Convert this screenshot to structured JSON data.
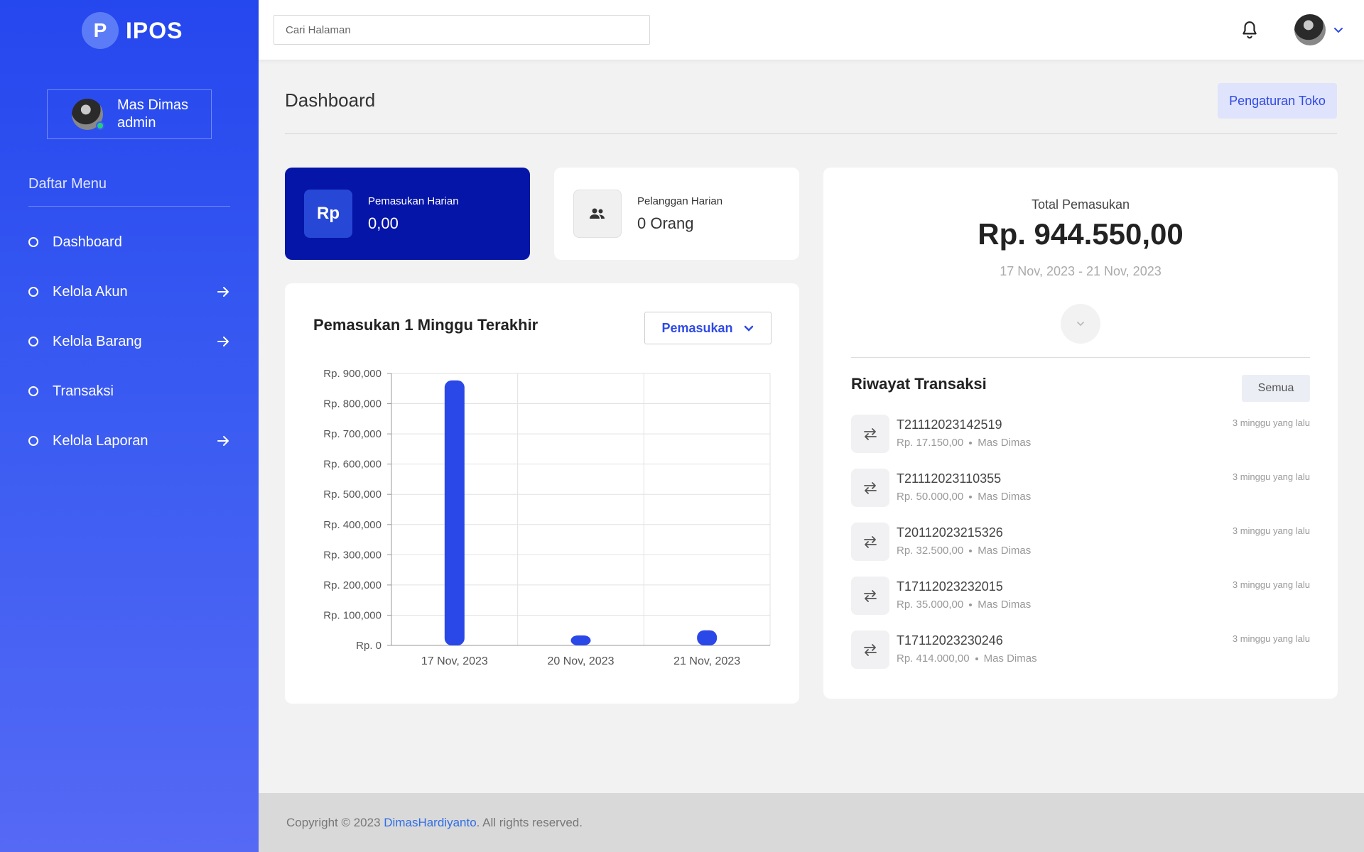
{
  "brand": {
    "logo_letter": "P",
    "name": "IPOS"
  },
  "user": {
    "name": "Mas Dimas",
    "role": "admin"
  },
  "sidebar": {
    "section_title": "Daftar Menu",
    "items": [
      {
        "label": "Dashboard",
        "has_arrow": false
      },
      {
        "label": "Kelola Akun",
        "has_arrow": true
      },
      {
        "label": "Kelola Barang",
        "has_arrow": true
      },
      {
        "label": "Transaksi",
        "has_arrow": false
      },
      {
        "label": "Kelola Laporan",
        "has_arrow": true
      }
    ]
  },
  "topbar": {
    "search_placeholder": "Cari Halaman"
  },
  "page": {
    "title": "Dashboard",
    "settings_label": "Pengaturan Toko"
  },
  "stats": {
    "income": {
      "icon_text": "Rp",
      "label": "Pemasukan Harian",
      "value": "0,00"
    },
    "customers": {
      "icon": "users-icon",
      "label": "Pelanggan Harian",
      "value": "0 Orang"
    }
  },
  "chart_card": {
    "title": "Pemasukan 1 Minggu Terakhir",
    "select_value": "Pemasukan"
  },
  "chart_data": {
    "type": "bar",
    "categories": [
      "17 Nov, 2023",
      "20 Nov, 2023",
      "21 Nov, 2023"
    ],
    "values": [
      877050,
      32500,
      50000
    ],
    "ylim": [
      0,
      900000
    ],
    "yticks": [
      "Rp. 0",
      "Rp. 100,000",
      "Rp. 200,000",
      "Rp. 300,000",
      "Rp. 400,000",
      "Rp. 500,000",
      "Rp. 600,000",
      "Rp. 700,000",
      "Rp. 800,000",
      "Rp. 900,000"
    ],
    "grid": true,
    "color": "#2a47e8"
  },
  "total": {
    "label": "Total Pemasukan",
    "value": "Rp. 944.550,00",
    "range": "17 Nov, 2023 - 21 Nov, 2023"
  },
  "history": {
    "title": "Riwayat Transaksi",
    "all_label": "Semua",
    "items": [
      {
        "id": "T21112023142519",
        "amount": "Rp. 17.150,00",
        "user": "Mas Dimas",
        "time": "3 minggu yang lalu"
      },
      {
        "id": "T21112023110355",
        "amount": "Rp. 50.000,00",
        "user": "Mas Dimas",
        "time": "3 minggu yang lalu"
      },
      {
        "id": "T20112023215326",
        "amount": "Rp. 32.500,00",
        "user": "Mas Dimas",
        "time": "3 minggu yang lalu"
      },
      {
        "id": "T17112023232015",
        "amount": "Rp. 35.000,00",
        "user": "Mas Dimas",
        "time": "3 minggu yang lalu"
      },
      {
        "id": "T17112023230246",
        "amount": "Rp. 414.000,00",
        "user": "Mas Dimas",
        "time": "3 minggu yang lalu"
      }
    ]
  },
  "footer": {
    "prefix": "Copyright © 2023 ",
    "link": "DimasHardiyanto",
    "suffix": ". All rights reserved."
  }
}
